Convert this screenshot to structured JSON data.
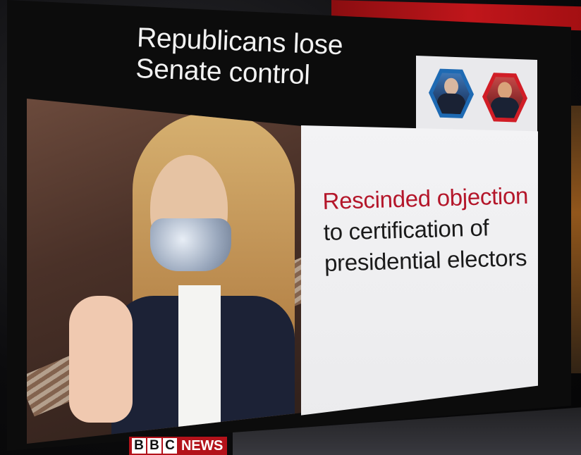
{
  "headline": {
    "line1": "Republicans lose",
    "line2": "Senate control"
  },
  "panel": {
    "accent_line": "Rescinded objection",
    "line2": "to certification of",
    "line3": "presidential electors"
  },
  "logo": {
    "letters": [
      "B",
      "B",
      "C"
    ],
    "word": "NEWS"
  },
  "colors": {
    "accent_red": "#b4162a",
    "bbc_red": "#b3121a",
    "hex_blue": "#1e6ab3",
    "hex_red": "#d11d26"
  }
}
